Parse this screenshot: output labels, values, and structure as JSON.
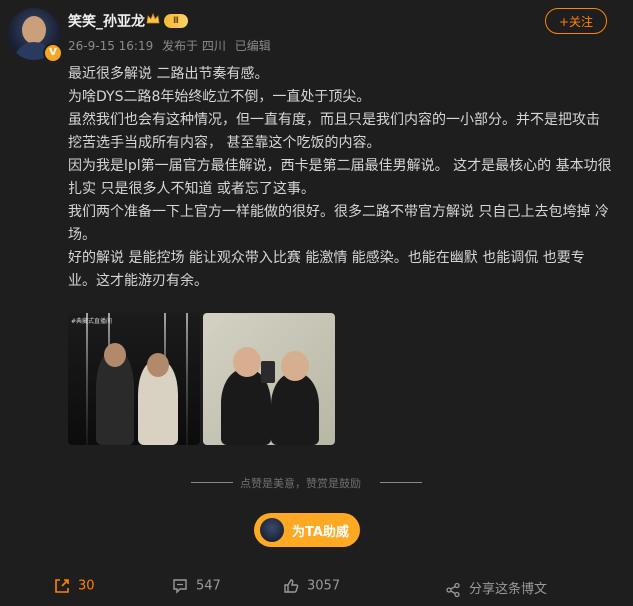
{
  "user": {
    "name": "笑笑_孙亚龙",
    "level_badge": "Ⅱ",
    "verified_mark": "V",
    "meta": [
      "26-9-15 16:19",
      "发布于 四川",
      "已编辑"
    ]
  },
  "follow_button": "+关注",
  "post": {
    "lines": [
      "最近很多解说 二路出节奏有感。",
      "为啥DYS二路8年始终屹立不倒，一直处于顶尖。",
      "虽然我们也会有这种情况，但一直有度，而且只是我们内容的一小部分。并不是把攻击 挖苦选手当成所有内容， 甚至靠这个吃饭的内容。",
      "因为我是lpl第一届官方最佳解说，西卡是第二届最佳男解说。 这才是最核心的 基本功很扎实 只是很多人不知道 或者忘了这事。",
      "我们两个准备一下上官方一样能做的很好。很多二路不带官方解说 只自己上去包垮掉 冷场。",
      "好的解说 是能控场 能让观众带入比赛 能激情 能感染。也能在幽默 也能调侃 也要专业。这才能游刃有余。"
    ],
    "photo1_caption": "#典藏式直播间"
  },
  "divider_text": "点赞是美意，赞赏是鼓励",
  "support_button": "为TA助威",
  "actions": {
    "repost": "30",
    "comment": "547",
    "like": "3057",
    "share": "分享这条博文"
  },
  "colors": {
    "accent": "#ff8200",
    "support": "#ffa823",
    "background": "#1e1e1e"
  }
}
